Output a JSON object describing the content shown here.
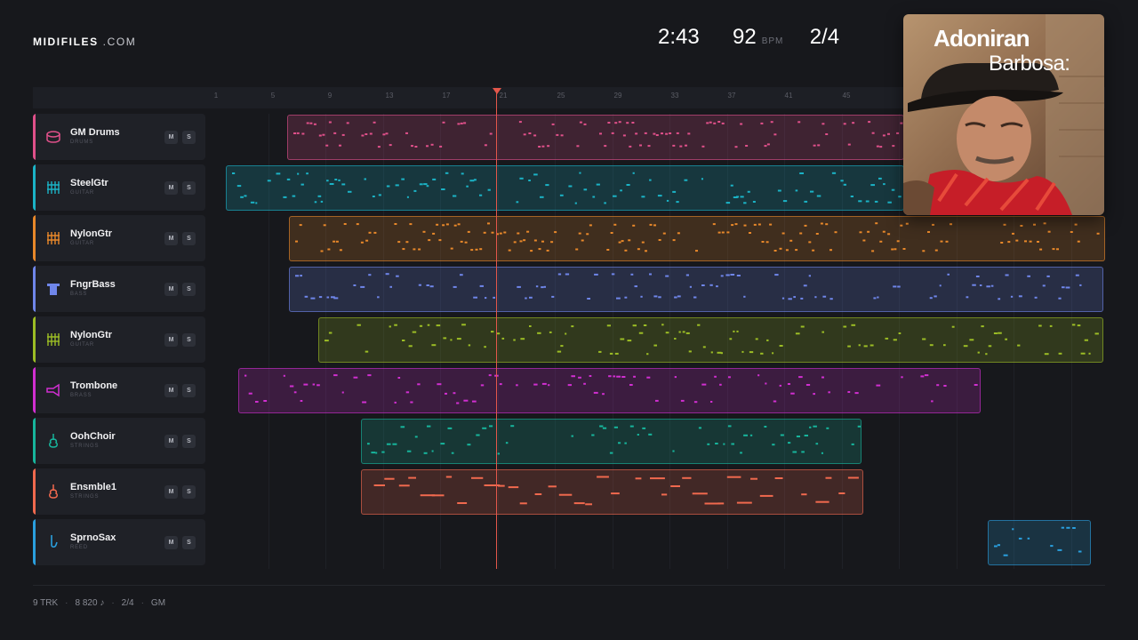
{
  "brand": {
    "name": "MIDIFILES",
    "suffix": ".COM"
  },
  "stats": {
    "time": "2:43",
    "bpm": "92",
    "bpm_unit": "BPM",
    "signature": "2/4"
  },
  "ruler": {
    "ticks": [
      "1",
      "5",
      "9",
      "13",
      "17",
      "21",
      "25",
      "29",
      "33",
      "37",
      "41",
      "45"
    ]
  },
  "tracks": [
    {
      "name": "GM Drums",
      "category": "DRUMS",
      "color": "#e0508a",
      "icon": "drum-icon",
      "mute": "M",
      "solo": "S"
    },
    {
      "name": "SteelGtr",
      "category": "GUITAR",
      "color": "#1bb3c6",
      "icon": "guitar-icon",
      "mute": "M",
      "solo": "S"
    },
    {
      "name": "NylonGtr",
      "category": "GUITAR",
      "color": "#e8882a",
      "icon": "guitar-icon",
      "mute": "M",
      "solo": "S"
    },
    {
      "name": "FngrBass",
      "category": "BASS",
      "color": "#6f86ea",
      "icon": "bass-icon",
      "mute": "M",
      "solo": "S"
    },
    {
      "name": "NylonGtr",
      "category": "GUITAR",
      "color": "#9cbd25",
      "icon": "guitar-icon",
      "mute": "M",
      "solo": "S"
    },
    {
      "name": "Trombone",
      "category": "BRASS",
      "color": "#d12fd1",
      "icon": "trombone-icon",
      "mute": "M",
      "solo": "S"
    },
    {
      "name": "OohChoir",
      "category": "STRINGS",
      "color": "#17b59c",
      "icon": "violin-icon",
      "mute": "M",
      "solo": "S"
    },
    {
      "name": "Ensmble1",
      "category": "STRINGS",
      "color": "#f0694e",
      "icon": "violin-icon",
      "mute": "M",
      "solo": "S"
    },
    {
      "name": "SprnoSax",
      "category": "REED",
      "color": "#2a9fde",
      "icon": "saxophone-icon",
      "mute": "M",
      "solo": "S"
    }
  ],
  "album": {
    "title_line1": "Adoniran",
    "title_line2": "Barbosa:"
  },
  "footer": {
    "tracks": "9 TRK",
    "notes": "8 820 ♪",
    "signature": "2/4",
    "standard": "GM"
  }
}
